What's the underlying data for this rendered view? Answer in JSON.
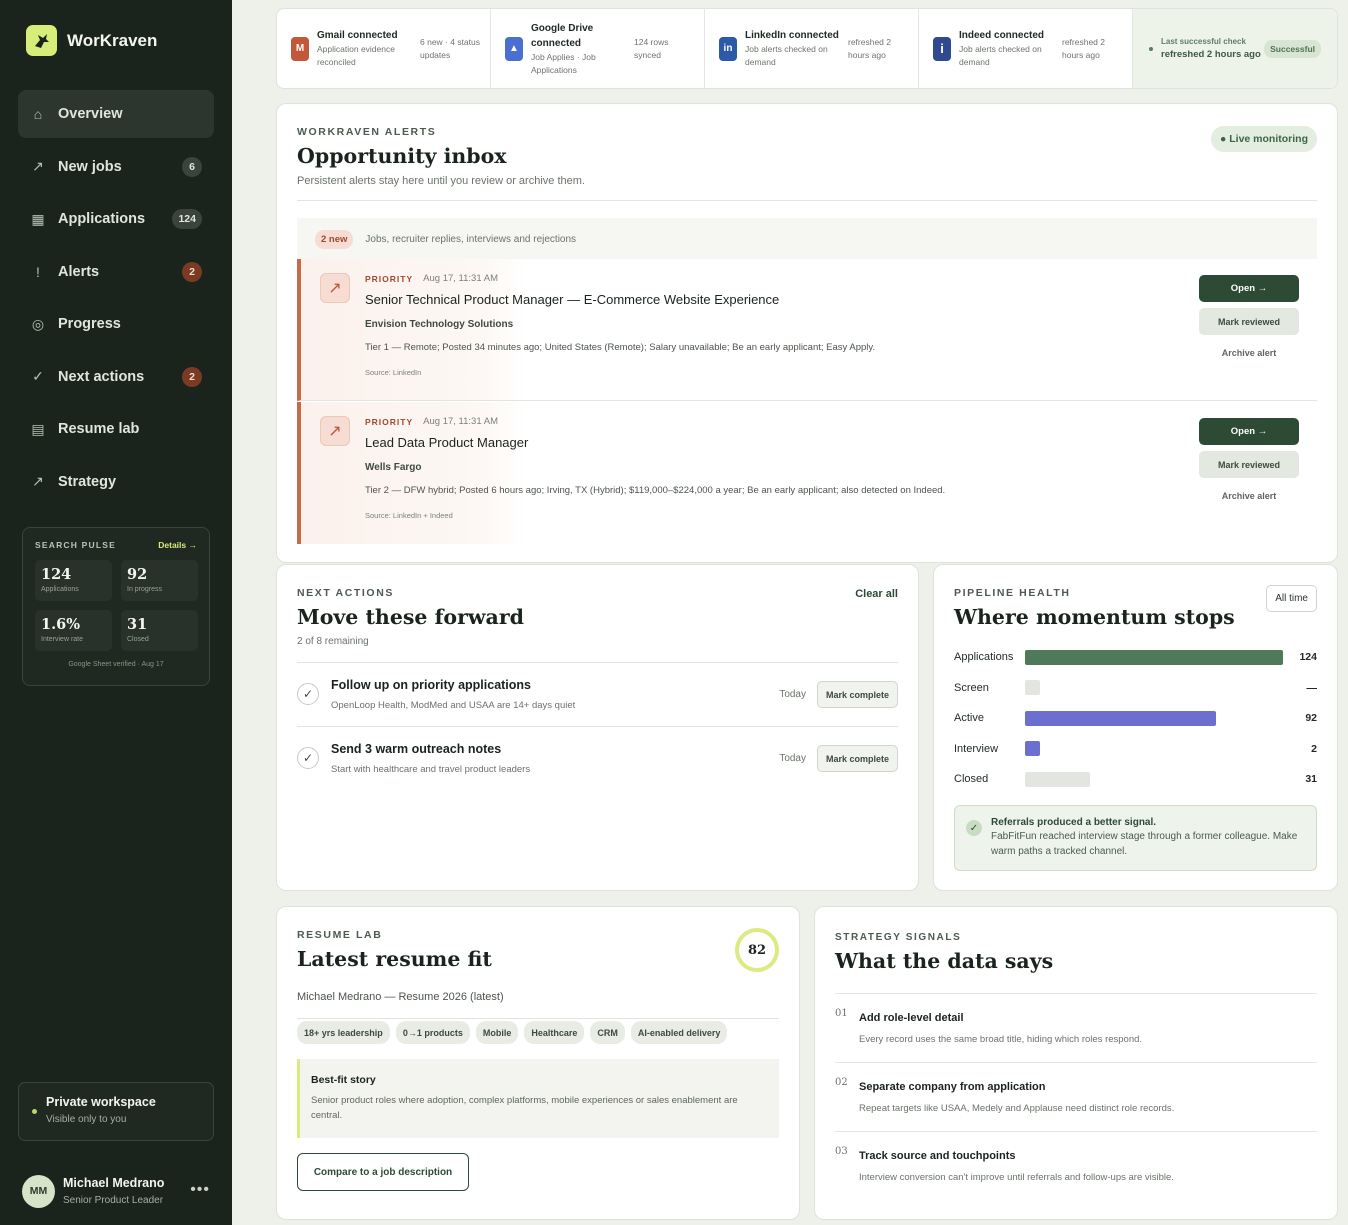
{
  "brand": {
    "name": "WorKraven"
  },
  "nav": [
    {
      "label": "Overview",
      "icon": "⌂",
      "icon_name": "home-icon",
      "badge": ""
    },
    {
      "label": "New jobs",
      "icon": "↗",
      "icon_name": "trend-icon",
      "badge": "6"
    },
    {
      "label": "Applications",
      "icon": "▦",
      "icon_name": "grid-icon",
      "badge": "124"
    },
    {
      "label": "Alerts",
      "icon": "!",
      "icon_name": "alert-icon",
      "badge": "2"
    },
    {
      "label": "Progress",
      "icon": "◎",
      "icon_name": "target-icon",
      "badge": ""
    },
    {
      "label": "Next actions",
      "icon": "✓",
      "icon_name": "check-icon",
      "badge": "2"
    },
    {
      "label": "Resume lab",
      "icon": "▤",
      "icon_name": "document-icon",
      "badge": ""
    },
    {
      "label": "Strategy",
      "icon": "↗",
      "icon_name": "trend-icon",
      "badge": ""
    }
  ],
  "pulse": {
    "title": "SEARCH PULSE",
    "details": "Details →",
    "stats": [
      {
        "value": "124",
        "label": "Applications"
      },
      {
        "value": "92",
        "label": "In progress"
      },
      {
        "value": "1.6%",
        "label": "Interview rate"
      },
      {
        "value": "31",
        "label": "Closed"
      }
    ],
    "footer": "Google Sheet verified · Aug 17"
  },
  "workspace": {
    "title": "Private workspace",
    "subtitle": "Visible only to you"
  },
  "user": {
    "initials": "MM",
    "name": "Michael Medrano",
    "role": "Senior Product Leader",
    "more": "•••"
  },
  "connections": [
    {
      "icon": "M",
      "color": "#c2573a",
      "name": "Gmail connected",
      "desc": "Application evidence reconciled",
      "meta": "6 new · 4 status updates"
    },
    {
      "icon": "▲",
      "color": "#4a6fd0",
      "name": "Google Drive connected",
      "desc": "Job Applies · Job Applications",
      "meta": "124 rows synced"
    },
    {
      "icon": "in",
      "color": "#2c5aa8",
      "name": "LinkedIn connected",
      "desc": "Job alerts checked on demand",
      "meta": "refreshed 2 hours ago"
    },
    {
      "icon": "i",
      "color": "#2f4a8f",
      "name": "Indeed connected",
      "desc": "Job alerts checked on demand",
      "meta": "refreshed 2 hours ago"
    }
  ],
  "last_check": {
    "title": "Last successful check",
    "sub": "refreshed 2 hours ago",
    "badge": "Successful"
  },
  "inbox": {
    "eyebrow": "WORKRAVEN ALERTS",
    "title": "Opportunity inbox",
    "subtitle": "Persistent alerts stay here until you review or archive them.",
    "live": "● Live monitoring",
    "new_pill": "2 new",
    "filter_text": "Jobs, recruiter replies, interviews and rejections",
    "alerts": [
      {
        "priority": "PRIORITY",
        "date": "Aug 17, 11:31 AM",
        "title": "Senior Technical Product Manager — E-Commerce Website Experience",
        "company": "Envision Technology Solutions",
        "desc": "Tier 1 — Remote; Posted 34 minutes ago; United States (Remote); Salary unavailable; Be an early applicant; Easy Apply.",
        "source": "Source: LinkedIn",
        "open": "Open →",
        "review": "Mark reviewed",
        "archive": "Archive alert"
      },
      {
        "priority": "PRIORITY",
        "date": "Aug 17, 11:31 AM",
        "title": "Lead Data Product Manager",
        "company": "Wells Fargo",
        "desc": "Tier 2 — DFW hybrid; Posted 6 hours ago; Irving, TX (Hybrid); $119,000–$224,000 a year; Be an early applicant; also detected on Indeed.",
        "source": "Source: LinkedIn + Indeed",
        "open": "Open →",
        "review": "Mark reviewed",
        "archive": "Archive alert"
      }
    ]
  },
  "next_actions": {
    "eyebrow": "NEXT ACTIONS",
    "title": "Move these forward",
    "subtitle": "2 of 8 remaining",
    "clear": "Clear all",
    "tasks": [
      {
        "title": "Follow up on priority applications",
        "sub": "OpenLoop Health, ModMed and USAA are 14+ days quiet",
        "when": "Today",
        "button": "Mark complete"
      },
      {
        "title": "Send 3 warm outreach notes",
        "sub": "Start with healthcare and travel product leaders",
        "when": "Today",
        "button": "Mark complete"
      }
    ]
  },
  "pipeline": {
    "eyebrow": "PIPELINE HEALTH",
    "title": "Where momentum stops",
    "filter": "All time",
    "rows": [
      {
        "label": "Applications",
        "value": "124",
        "n": 124,
        "color": "#4f7a5a"
      },
      {
        "label": "Screen",
        "value": "—",
        "n": 0,
        "color": "#e3e5e0"
      },
      {
        "label": "Active",
        "value": "92",
        "n": 92,
        "color": "#6a6fd0"
      },
      {
        "label": "Interview",
        "value": "2",
        "n": 2,
        "color": "#6a6fd0"
      },
      {
        "label": "Closed",
        "value": "31",
        "n": 31,
        "color": "#e3e5e0"
      }
    ],
    "insight_title": "Referrals produced a better signal.",
    "insight_body": "FabFitFun reached interview stage through a former colleague. Make warm paths a tracked channel."
  },
  "resume": {
    "eyebrow": "RESUME LAB",
    "title": "Latest resume fit",
    "score": "82",
    "name": "Michael Medrano — Resume 2026 (latest)",
    "chips": [
      "18+ yrs leadership",
      "0→1 products",
      "Mobile",
      "Healthcare",
      "CRM",
      "AI-enabled delivery"
    ],
    "story_title": "Best-fit story",
    "story_body": "Senior product roles where adoption, complex platforms, mobile experiences or sales enablement are central.",
    "compare": "Compare to a job description"
  },
  "strategy": {
    "eyebrow": "STRATEGY SIGNALS",
    "title": "What the data says",
    "signals": [
      {
        "num": "01",
        "title": "Add role-level detail",
        "body": "Every record uses the same broad title, hiding which roles respond."
      },
      {
        "num": "02",
        "title": "Separate company from application",
        "body": "Repeat targets like USAA, Medely and Applause need distinct role records."
      },
      {
        "num": "03",
        "title": "Track source and touchpoints",
        "body": "Interview conversion can't improve until referrals and follow-ups are visible."
      }
    ]
  }
}
